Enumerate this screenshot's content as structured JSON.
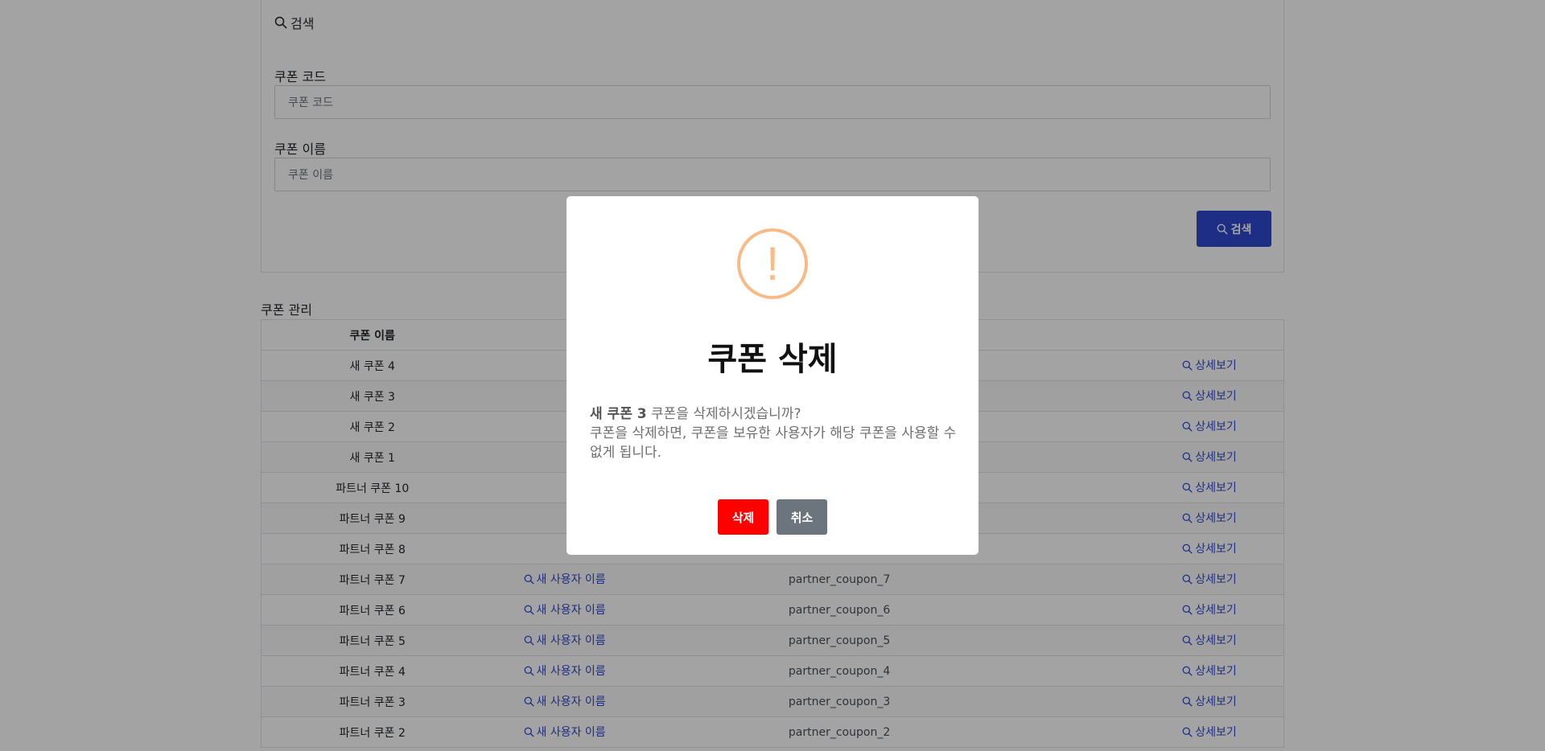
{
  "search": {
    "header": "검색",
    "coupon_code_label": "쿠폰 코드",
    "coupon_code_placeholder": "쿠폰 코드",
    "coupon_name_label": "쿠폰 이름",
    "coupon_name_placeholder": "쿠폰 이름",
    "button_label": "검색"
  },
  "table": {
    "title": "쿠폰 관리",
    "header": {
      "name": "쿠폰 이름"
    },
    "detail_label": "상세보기",
    "rows": [
      {
        "name": "새 쿠폰 4",
        "user": "",
        "code": ""
      },
      {
        "name": "새 쿠폰 3",
        "user": "",
        "code": ""
      },
      {
        "name": "새 쿠폰 2",
        "user": "",
        "code": ""
      },
      {
        "name": "새 쿠폰 1",
        "user": "",
        "code": ""
      },
      {
        "name": "파트너 쿠폰 10",
        "user": "",
        "code": ""
      },
      {
        "name": "파트너 쿠폰 9",
        "user": "",
        "code": ""
      },
      {
        "name": "파트너 쿠폰 8",
        "user": "",
        "code": ""
      },
      {
        "name": "파트너 쿠폰 7",
        "user": "새 사용자 이름",
        "code": "partner_coupon_7"
      },
      {
        "name": "파트너 쿠폰 6",
        "user": "새 사용자 이름",
        "code": "partner_coupon_6"
      },
      {
        "name": "파트너 쿠폰 5",
        "user": "새 사용자 이름",
        "code": "partner_coupon_5"
      },
      {
        "name": "파트너 쿠폰 4",
        "user": "새 사용자 이름",
        "code": "partner_coupon_4"
      },
      {
        "name": "파트너 쿠폰 3",
        "user": "새 사용자 이름",
        "code": "partner_coupon_3"
      },
      {
        "name": "파트너 쿠폰 2",
        "user": "새 사용자 이름",
        "code": "partner_coupon_2"
      }
    ]
  },
  "modal": {
    "icon": "exclamation-icon",
    "title": "쿠폰 삭제",
    "target_name": "새 쿠폰 3",
    "line1_suffix": " 쿠폰을 삭제하시겠습니까?",
    "line2": "쿠폰을 삭제하면, 쿠폰을 보유한 사용자가 해당 쿠폰을 사용할 수 없게 됩니다.",
    "delete_label": "삭제",
    "cancel_label": "취소"
  },
  "colors": {
    "primary": "#2f49d1",
    "danger": "#ff0000",
    "secondary": "#6c757d",
    "warning_icon": "#f8bb86"
  }
}
